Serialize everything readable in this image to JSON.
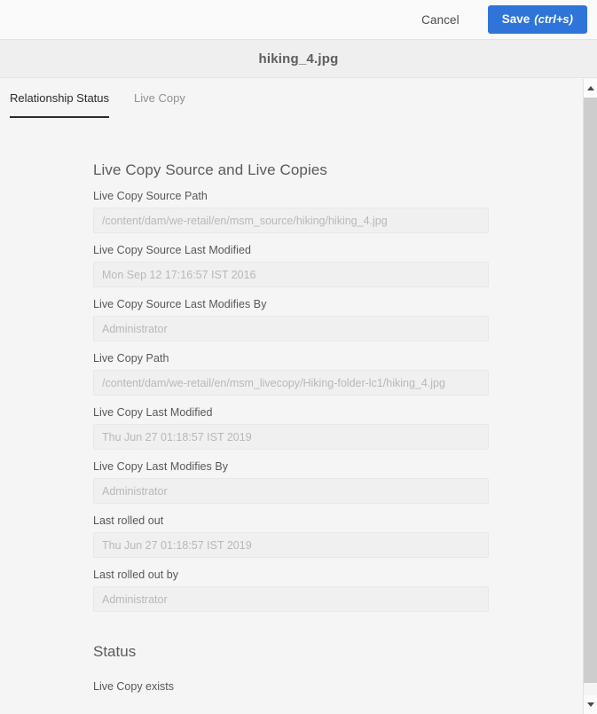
{
  "toolbar": {
    "cancel_label": "Cancel",
    "save_label": "Save",
    "save_shortcut": "(ctrl+s)",
    "accent_color": "#2f74d8"
  },
  "titlebar": {
    "doc_title": "hiking_4.jpg"
  },
  "tabs": [
    {
      "label": "Relationship Status",
      "active": true
    },
    {
      "label": "Live Copy",
      "active": false
    }
  ],
  "main": {
    "section_heading": "Live Copy Source and Live Copies",
    "fields": [
      {
        "label": "Live Copy Source Path",
        "value": "/content/dam/we-retail/en/msm_source/hiking/hiking_4.jpg"
      },
      {
        "label": "Live Copy Source Last Modified",
        "value": "Mon Sep 12 17:16:57 IST 2016"
      },
      {
        "label": "Live Copy Source Last Modifies By",
        "value": "Administrator"
      },
      {
        "label": "Live Copy Path",
        "value": "/content/dam/we-retail/en/msm_livecopy/Hiking-folder-lc1/hiking_4.jpg"
      },
      {
        "label": "Live Copy Last Modified",
        "value": "Thu Jun 27 01:18:57 IST 2019"
      },
      {
        "label": "Live Copy Last Modifies By",
        "value": "Administrator"
      },
      {
        "label": "Last rolled out",
        "value": "Thu Jun 27 01:18:57 IST 2019"
      },
      {
        "label": "Last rolled out by",
        "value": "Administrator"
      }
    ],
    "status_heading": "Status",
    "status_text": "Live Copy exists"
  }
}
